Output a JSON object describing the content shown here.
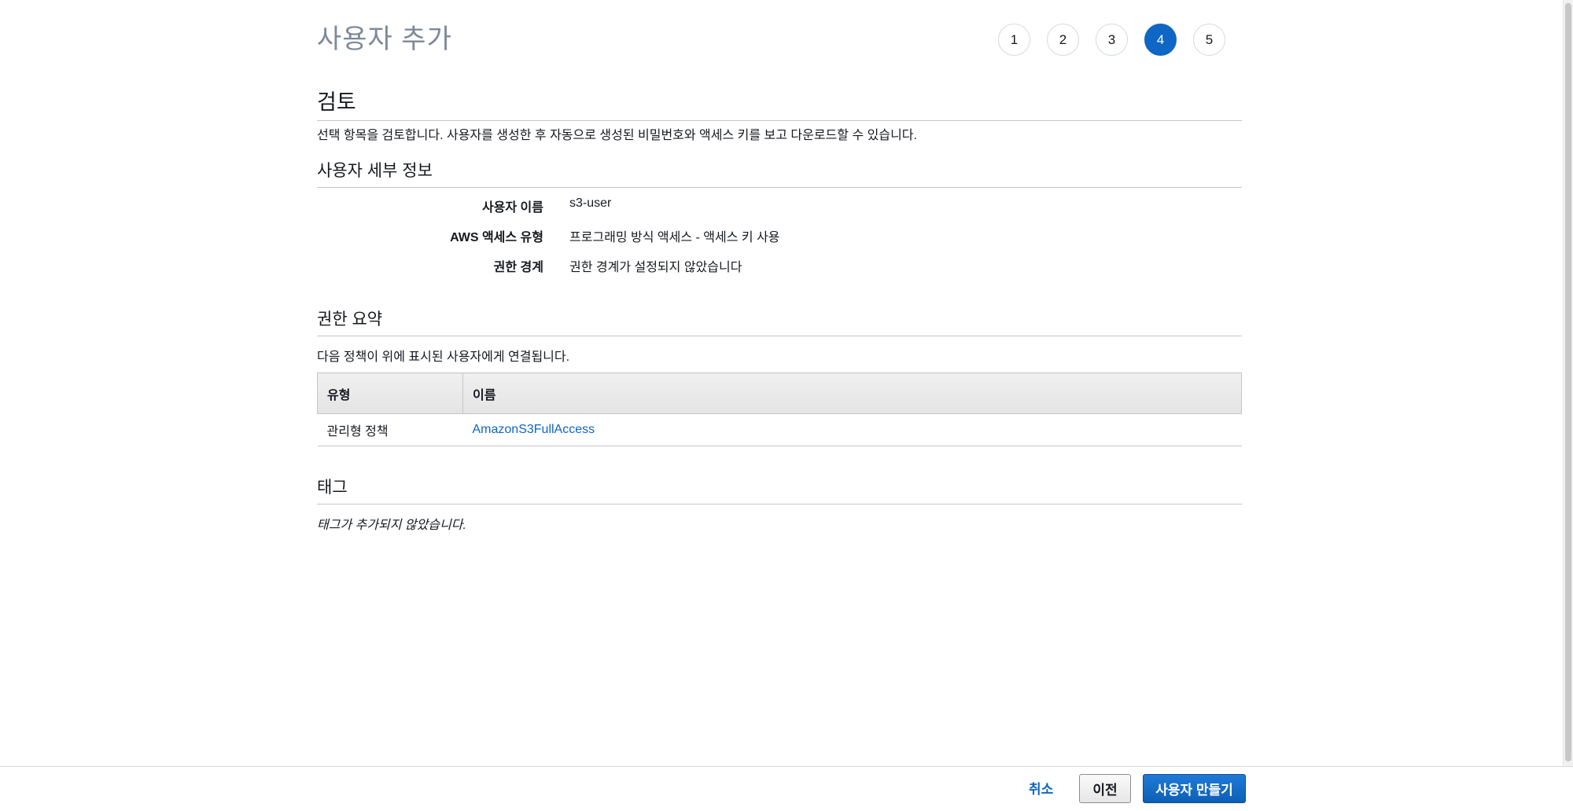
{
  "header": {
    "title": "사용자 추가",
    "steps": [
      "1",
      "2",
      "3",
      "4",
      "5"
    ],
    "active_step": "4"
  },
  "review": {
    "heading": "검토",
    "description": "선택 항목을 검토합니다. 사용자를 생성한 후 자동으로 생성된 비밀번호와 액세스 키를 보고 다운로드할 수 있습니다."
  },
  "user_details": {
    "heading": "사용자 세부 정보",
    "rows": [
      {
        "label": "사용자 이름",
        "value": "s3-user"
      },
      {
        "label": "AWS 액세스 유형",
        "value": "프로그래밍 방식 액세스 - 액세스 키 사용"
      },
      {
        "label": "권한 경계",
        "value": "권한 경계가 설정되지 않았습니다"
      }
    ]
  },
  "permissions": {
    "heading": "권한 요약",
    "description": "다음 정책이 위에 표시된 사용자에게 연결됩니다.",
    "columns": [
      "유형",
      "이름"
    ],
    "rows": [
      {
        "type": "관리형 정책",
        "name": "AmazonS3FullAccess"
      }
    ]
  },
  "tags": {
    "heading": "태그",
    "empty_text": "태그가 추가되지 않았습니다."
  },
  "footer": {
    "cancel_label": "취소",
    "previous_label": "이전",
    "create_label": "사용자 만들기"
  },
  "colors": {
    "accent": "#0f66c4",
    "title_gray": "#7d8998",
    "divider": "#c6c6c6"
  }
}
